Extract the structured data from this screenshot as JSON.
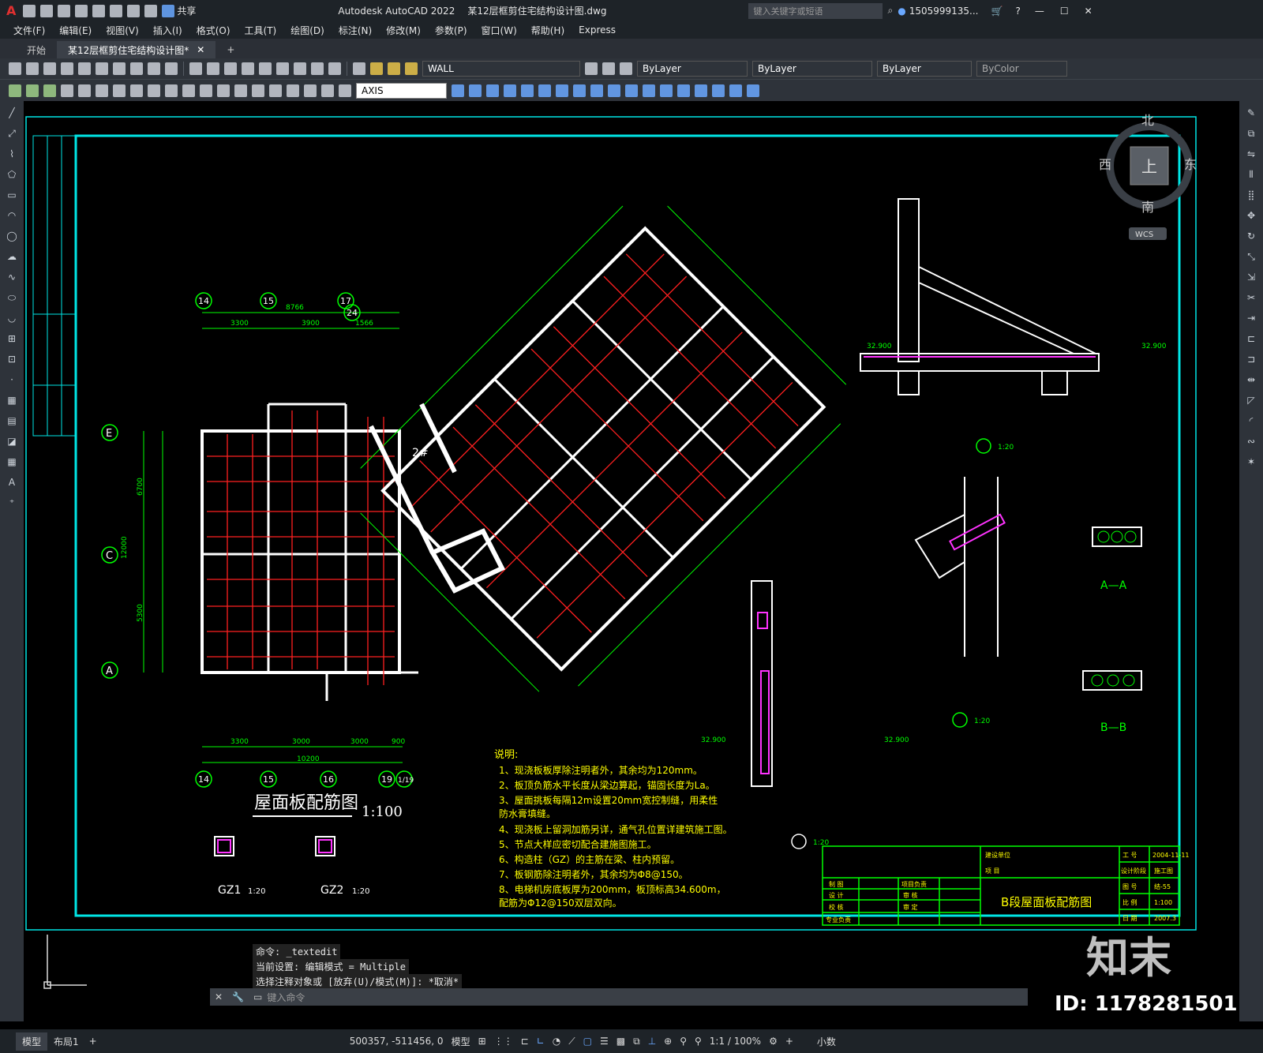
{
  "titlebar": {
    "logo": "A",
    "share": "共享",
    "app_title": "Autodesk AutoCAD 2022",
    "file_title": "某12层框剪住宅结构设计图.dwg",
    "search_placeholder": "键入关键字或短语",
    "user": "1505999135...",
    "icons": [
      "new-icon",
      "open-icon",
      "save-icon",
      "saveas-icon",
      "publish-icon",
      "plot-icon",
      "undo-icon",
      "redo-icon",
      "share-icon",
      "search-icon",
      "user-icon",
      "cart-icon",
      "help-icon",
      "minimize-icon",
      "maximize-icon",
      "close-icon"
    ]
  },
  "menu": [
    "文件(F)",
    "编辑(E)",
    "视图(V)",
    "插入(I)",
    "格式(O)",
    "工具(T)",
    "绘图(D)",
    "标注(N)",
    "修改(M)",
    "参数(P)",
    "窗口(W)",
    "帮助(H)",
    "Express"
  ],
  "tabs": [
    {
      "label": "开始",
      "active": false
    },
    {
      "label": "某12层框剪住宅结构设计图*",
      "active": true
    }
  ],
  "toolbar": {
    "layer": "WALL",
    "color": "ByLayer",
    "linetype": "ByLayer",
    "lineweight": "ByLayer",
    "plotstyle": "ByColor",
    "dimstyle": "AXIS"
  },
  "viewcube": {
    "north": "北",
    "south": "南",
    "east": "东",
    "west": "西",
    "top": "上",
    "wcs": "WCS"
  },
  "drawing": {
    "title": "屋面板配筋图",
    "scale": "1:100",
    "notes_title": "说明:",
    "notes": [
      "1、现浇板板厚除注明者外，其余均为120mm。",
      "2、板顶负筋水平长度从梁边算起，锚固长度为La。",
      "3、屋面挑板每隔12m设置20mm宽控制缝，用柔性",
      "   防水膏填缝。",
      "4、现浇板上留洞加筋另详，通气孔位置详建筑施工图。",
      "5、节点大样应密切配合建施图施工。",
      "6、构造柱（GZ）的主筋在梁、柱内预留。",
      "7、板钢筋除注明者外，其余均为Φ8@150。",
      "8、电梯机房底板厚为200mm，板顶标高34.600m，",
      "   配筋为Φ12@150双层双向。"
    ],
    "gz1": "GZ1",
    "gz1_scale": "1:20",
    "gz2": "GZ2",
    "gz2_scale": "1:20",
    "section_aa": "A—A",
    "section_bb": "B—B",
    "detail1_scale": "1:20",
    "detail2_scale": "1:20",
    "detail3_scale": "1:20",
    "elev_3290": "32.900",
    "stair": "2#",
    "titleblock": {
      "name": "B段屋面板配筋图",
      "rows": [
        "制 图",
        "设 计",
        "校 核",
        "专业负责"
      ],
      "role_cols": [
        "项目负责",
        "审 核",
        "审 定"
      ],
      "project_labels": [
        "建设单位",
        "项 目"
      ],
      "right_labels": [
        "工 号",
        "设计阶段",
        "图 号",
        "比 例",
        "日 期"
      ],
      "right_values": [
        "2004-11-11",
        "施工图",
        "结-55",
        "1:100",
        "2007.3"
      ]
    }
  },
  "axes_left": [
    "E",
    "C",
    "A"
  ],
  "axes_top": [
    "14",
    "15",
    "17",
    "24"
  ],
  "axes_bottom": [
    "14",
    "15",
    "16",
    "19",
    "1/19"
  ],
  "dims": {
    "top_a": "8766",
    "top_b": "3300",
    "top_c": "3900",
    "top_d": "1566",
    "bot_a": "3300",
    "bot_b": "3000",
    "bot_c": "3000",
    "bot_d": "900",
    "bot_total": "10200",
    "left_a": "6700",
    "left_b": "12000",
    "left_c": "5300"
  },
  "command": {
    "lines": [
      "命令: _textedit",
      "当前设置: 编辑模式 = Multiple",
      "选择注释对象或 [放弃(U)/模式(M)]: *取消*"
    ],
    "placeholder": "键入命令"
  },
  "status": {
    "model_tab": "模型",
    "layout_tab": "布局1",
    "coords": "500357, -511456, 0",
    "model": "模型",
    "scale": "1:1 / 100%",
    "units": "小数"
  },
  "watermark": {
    "brand": "知末",
    "id": "ID: 1178281501"
  },
  "colors": {
    "green": "#00ff00",
    "cyan": "#00e6e6",
    "red": "#ff2020",
    "white": "#ffffff",
    "magenta": "#ff33ff",
    "yellow": "#ffff00"
  }
}
